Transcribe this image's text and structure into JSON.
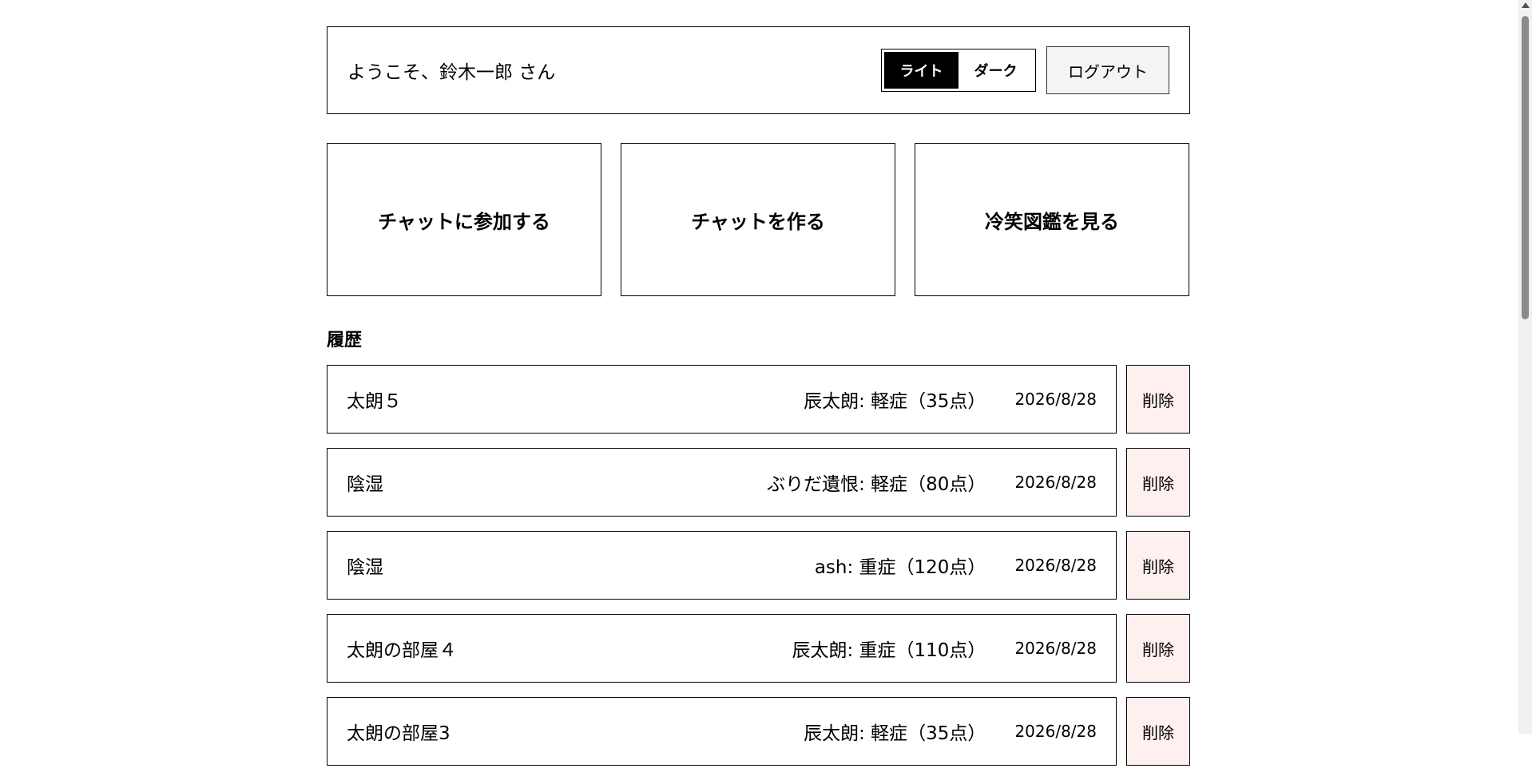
{
  "header": {
    "welcome": "ようこそ、鈴木一郎 さん",
    "theme": {
      "light": "ライト",
      "dark": "ダーク",
      "selected": "light"
    },
    "logout_label": "ログアウト"
  },
  "actions": [
    {
      "label": "チャットに参加する"
    },
    {
      "label": "チャットを作る"
    },
    {
      "label": "冷笑図鑑を見る"
    }
  ],
  "history": {
    "title": "履歴",
    "delete_label": "削除",
    "items": [
      {
        "title": "太朗５",
        "result": "辰太朗: 軽症（35点）",
        "date": "2026/8/28"
      },
      {
        "title": "陰湿",
        "result": "ぶりだ遺恨: 軽症（80点）",
        "date": "2026/8/28"
      },
      {
        "title": "陰湿",
        "result": "ash: 重症（120点）",
        "date": "2026/8/28"
      },
      {
        "title": "太朗の部屋４",
        "result": "辰太朗: 重症（110点）",
        "date": "2026/8/28"
      },
      {
        "title": "太朗の部屋3",
        "result": "辰太朗: 軽症（35点）",
        "date": "2026/8/28"
      }
    ]
  },
  "colors": {
    "delete_bg": "#fff0f0",
    "logout_bg": "#f3f4f6",
    "border": "#000000"
  }
}
